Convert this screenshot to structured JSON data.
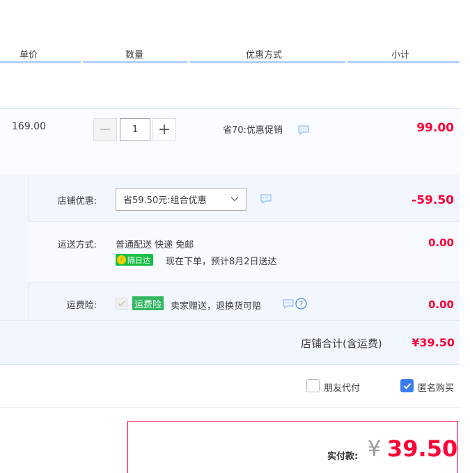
{
  "header": {
    "unit_price": "单价",
    "quantity": "数量",
    "discount_method": "优惠方式",
    "subtotal": "小计"
  },
  "item": {
    "unit_price": "169.00",
    "quantity": "1",
    "minus": "−",
    "plus": "+",
    "promo": "省70:优惠促销",
    "subtotal": "99.00"
  },
  "shop": {
    "discount_label": "店铺优惠:",
    "discount_select": "省59.50元:组合优惠",
    "discount_amount": "-59.50",
    "shipping_label": "运送方式:",
    "shipping_method": "普通配送 快递 免邮",
    "next_day_badge": "隔日达",
    "delivery_eta": "现在下单，预计8月2日送达",
    "shipping_amount": "0.00",
    "insurance_label": "运费险:",
    "insurance_badge": "运费险",
    "insurance_text": "卖家赠送，退换货可赔",
    "insurance_amount": "0.00",
    "total_label": "店铺合计(含运费)",
    "total_amount": "¥39.50"
  },
  "options": {
    "friend_pay": "朋友代付",
    "anonymous": "匿名购买"
  },
  "payment": {
    "label": "实付款:",
    "currency": "¥",
    "amount": "39.50"
  },
  "colors": {
    "accent_red": "#ff0036",
    "header_bar": "#b2d1ff",
    "checkbox_blue": "#3b7dee",
    "badge_green": "#15c047"
  }
}
